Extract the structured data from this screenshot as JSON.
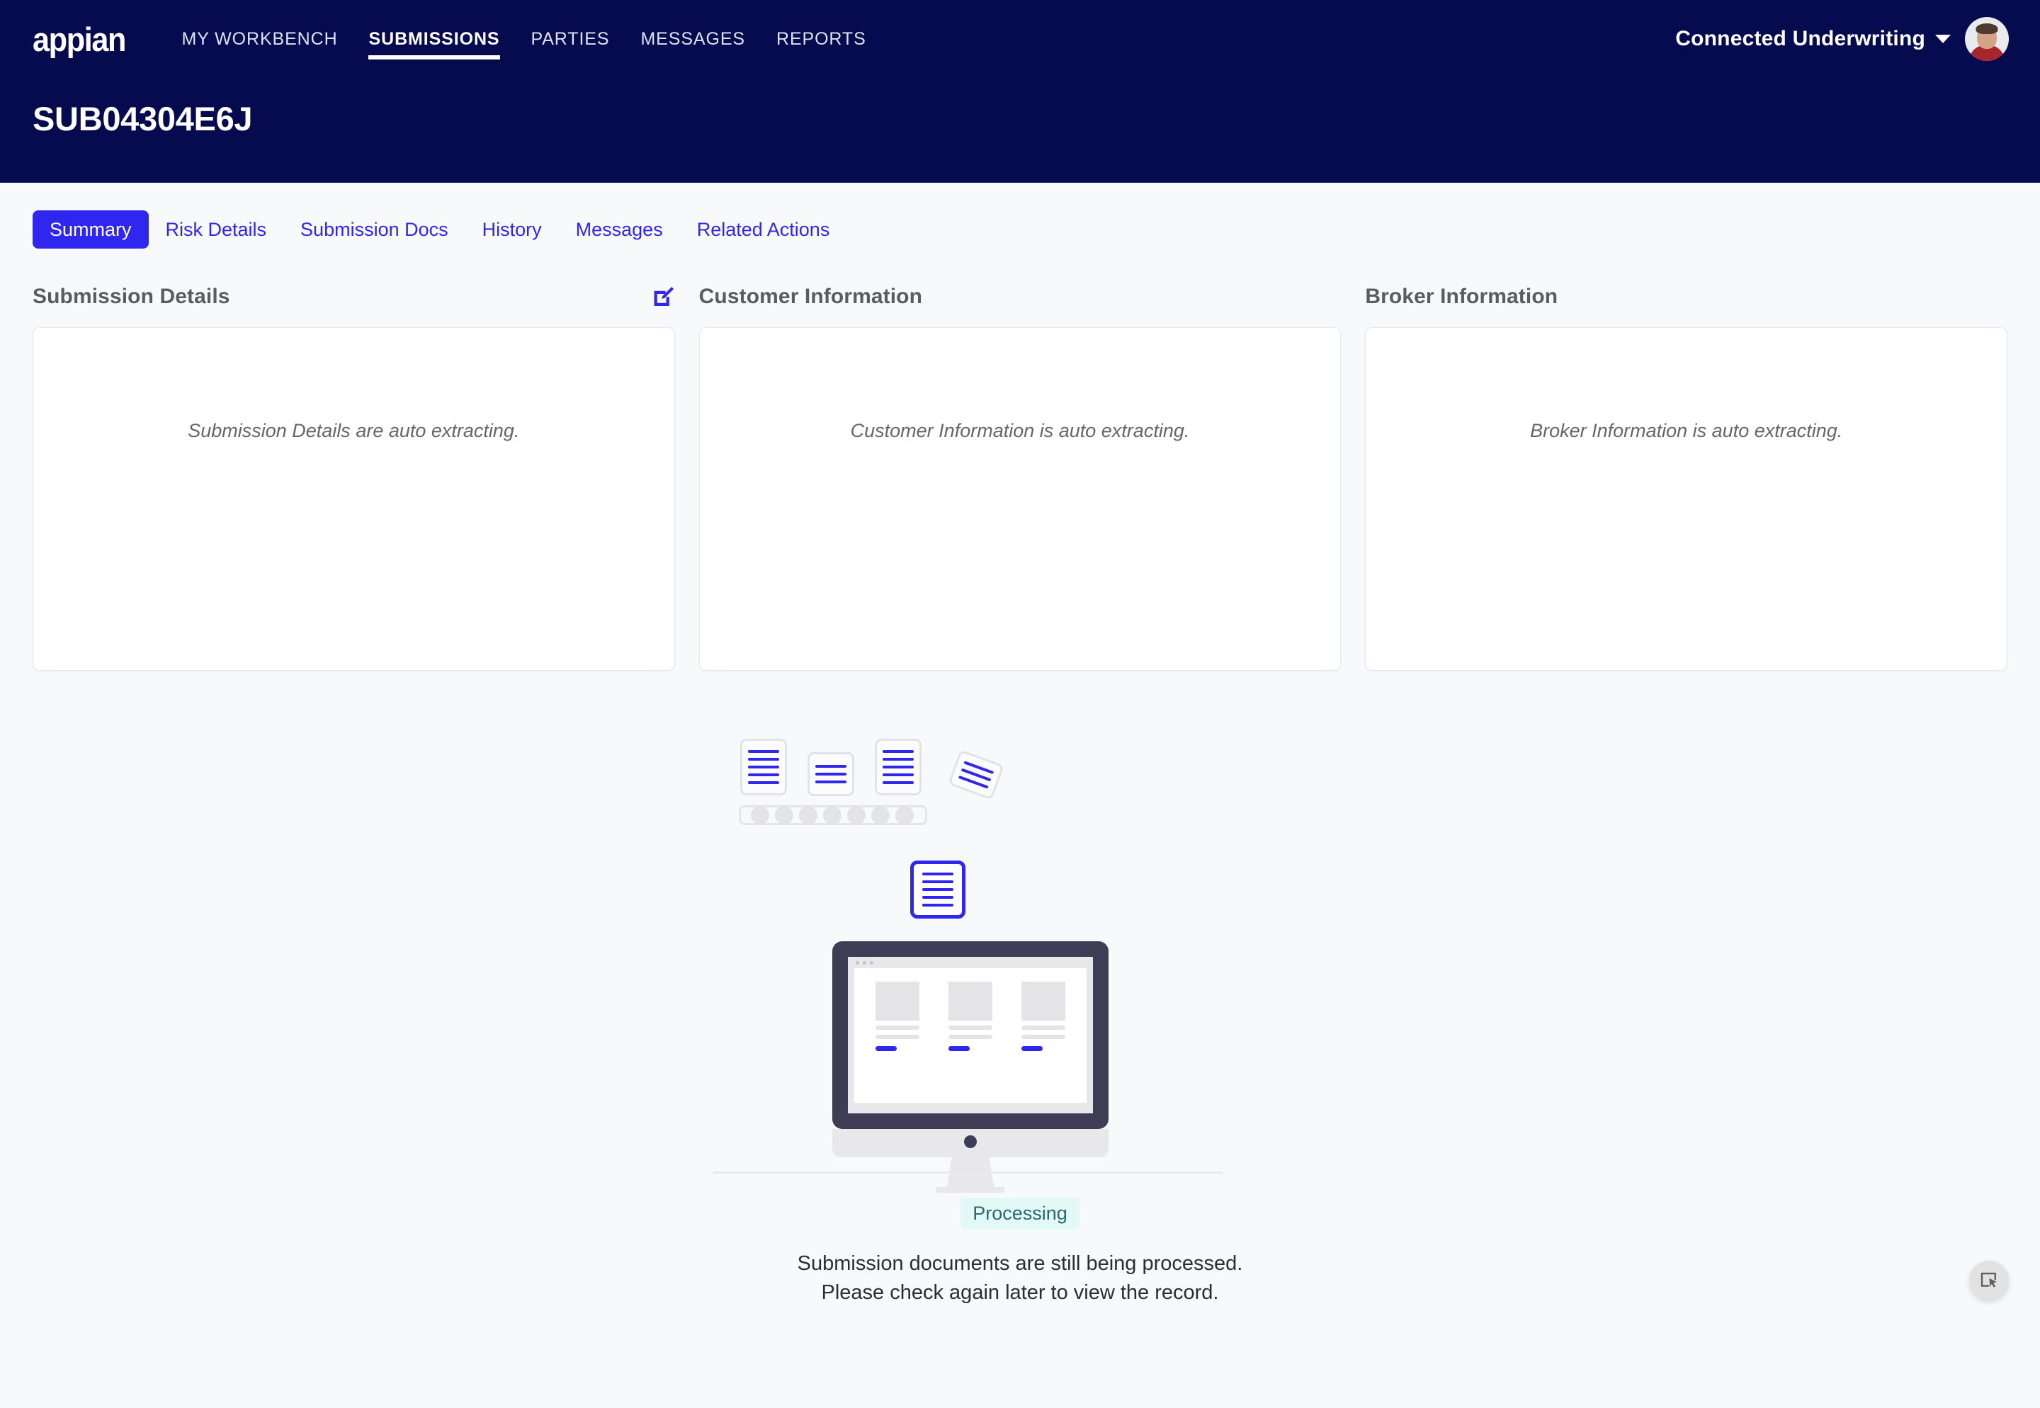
{
  "brand": {
    "logo_text": "appian",
    "nav_bg": "#060a4f",
    "accent": "#2f27f0"
  },
  "topnav": {
    "items": [
      {
        "label": "MY WORKBENCH",
        "active": false
      },
      {
        "label": "SUBMISSIONS",
        "active": true
      },
      {
        "label": "PARTIES",
        "active": false
      },
      {
        "label": "MESSAGES",
        "active": false
      },
      {
        "label": "REPORTS",
        "active": false
      }
    ],
    "account_name": "Connected Underwriting"
  },
  "header": {
    "title": "SUB04304E6J"
  },
  "tabs": [
    {
      "label": "Summary",
      "active": true
    },
    {
      "label": "Risk Details",
      "active": false
    },
    {
      "label": "Submission Docs",
      "active": false
    },
    {
      "label": "History",
      "active": false
    },
    {
      "label": "Messages",
      "active": false
    },
    {
      "label": "Related Actions",
      "active": false
    }
  ],
  "cards": [
    {
      "title": "Submission Details",
      "message": "Submission Details are auto extracting.",
      "has_edit": true
    },
    {
      "title": "Customer Information",
      "message": "Customer Information is auto extracting.",
      "has_edit": false
    },
    {
      "title": "Broker Information",
      "message": "Broker Information is auto extracting.",
      "has_edit": false
    }
  ],
  "status": {
    "badge_label": "Processing",
    "badge_bg": "#e2f9f8",
    "badge_color": "#2b6a6b",
    "message_line1": "Submission documents are still being processed.",
    "message_line2": "Please check again later to view the record."
  },
  "illustration": {
    "belt_dot_count": 7,
    "doc_line_counts": [
      5,
      3,
      5,
      3
    ],
    "big_doc_line_count": 5,
    "monitor_card_count": 3
  },
  "fab": {
    "icon": "select-region-cursor-icon"
  }
}
